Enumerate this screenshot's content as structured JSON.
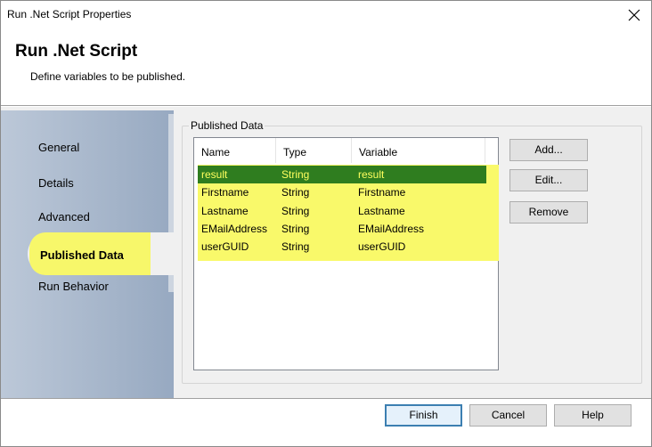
{
  "window": {
    "title": "Run .Net Script Properties"
  },
  "header": {
    "title": "Run .Net Script",
    "subtitle": "Define variables to be published."
  },
  "sidebar": {
    "items": [
      {
        "label": "General"
      },
      {
        "label": "Details"
      },
      {
        "label": "Advanced"
      },
      {
        "label": "Published Data",
        "active": true
      },
      {
        "label": "Run Behavior"
      }
    ]
  },
  "published": {
    "group_label": "Published Data",
    "columns": [
      "Name",
      "Type",
      "Variable"
    ],
    "rows": [
      {
        "name": "result",
        "type": "String",
        "variable": "result",
        "selected": true
      },
      {
        "name": "Firstname",
        "type": "String",
        "variable": "Firstname"
      },
      {
        "name": "Lastname",
        "type": "String",
        "variable": "Lastname"
      },
      {
        "name": "EMailAddress",
        "type": "String",
        "variable": "EMailAddress"
      },
      {
        "name": "userGUID",
        "type": "String",
        "variable": "userGUID"
      }
    ],
    "buttons": {
      "add": "Add...",
      "edit": "Edit...",
      "remove": "Remove"
    }
  },
  "footer": {
    "finish": "Finish",
    "cancel": "Cancel",
    "help": "Help"
  },
  "colors": {
    "highlight": "#f9f96a",
    "selection": "#2f7d1f",
    "selection_text": "#ffff5e"
  },
  "icons": {
    "close": "close-icon"
  }
}
